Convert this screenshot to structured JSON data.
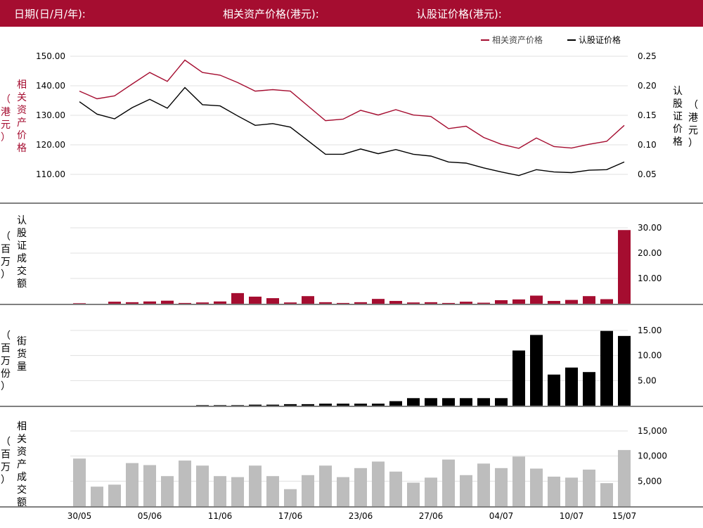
{
  "header": {
    "date_label": "日期(日/月/年):",
    "asset_label": "相关资产价格(港元):",
    "warrant_label": "认股证价格(港元):",
    "bg": "#a50d30"
  },
  "colors": {
    "accent": "#a50d30",
    "black": "#000000",
    "gray": "#bdbdbd",
    "grid": "#e0e0e0"
  },
  "panel_labels": {
    "asset_price": {
      "main": [
        "相",
        "关",
        "资",
        "产",
        "价",
        "格"
      ],
      "unit": [
        "（",
        "港",
        "元",
        "）"
      ]
    },
    "warrant_price": {
      "main": [
        "认",
        "股",
        "证",
        "价",
        "格"
      ],
      "unit": [
        "（",
        "港",
        "元",
        "）"
      ]
    },
    "warrant_turnover": {
      "main": [
        "认",
        "股",
        "证",
        "成",
        "交",
        "额"
      ],
      "unit": [
        "（",
        "百",
        "万",
        "）"
      ]
    },
    "outstanding": {
      "main": [
        "街",
        "货",
        "量"
      ],
      "unit": [
        "（",
        "百",
        "万",
        "份",
        "）"
      ]
    },
    "asset_turnover": {
      "main": [
        "相",
        "关",
        "资",
        "产",
        "成",
        "交",
        "额"
      ],
      "unit": [
        "（",
        "百",
        "万",
        "）"
      ]
    }
  },
  "chart_data": [
    {
      "type": "line",
      "legend": [
        "相关资产价格",
        "认股证价格"
      ],
      "legend_position": "top-right",
      "x_tick_labels": [
        "30/05",
        "05/06",
        "11/06",
        "17/06",
        "23/06",
        "27/06",
        "04/07",
        "10/07",
        "15/07"
      ],
      "y_left": {
        "ticks": [
          "150.00",
          "140.00",
          "130.00",
          "120.00",
          "110.00"
        ],
        "range": [
          103,
          156
        ]
      },
      "y_right": {
        "ticks": [
          "0.25",
          "0.20",
          "0.15",
          "0.10",
          "0.05"
        ],
        "range": [
          0.018,
          0.257
        ]
      },
      "series": [
        {
          "name": "相关资产价格",
          "axis": "left",
          "color": "#a50d30",
          "values": [
            138.2,
            135.6,
            136.6,
            140.6,
            144.5,
            141.5,
            148.7,
            144.5,
            143.6,
            141.1,
            138.2,
            138.7,
            138.2,
            133.2,
            128.2,
            128.7,
            131.7,
            130.1,
            131.9,
            130.1,
            129.6,
            125.5,
            126.3,
            122.5,
            120.2,
            118.8,
            122.3,
            119.4,
            118.9,
            120.2,
            121.2,
            126.6
          ]
        },
        {
          "name": "认股证价格",
          "axis": "right",
          "color": "#000000",
          "values": [
            0.173,
            0.152,
            0.144,
            0.163,
            0.177,
            0.162,
            0.197,
            0.168,
            0.166,
            0.149,
            0.133,
            0.136,
            0.13,
            0.107,
            0.084,
            0.084,
            0.093,
            0.085,
            0.092,
            0.084,
            0.081,
            0.071,
            0.069,
            0.061,
            0.054,
            0.048,
            0.058,
            0.054,
            0.053,
            0.057,
            0.058,
            0.071
          ]
        }
      ]
    },
    {
      "type": "bar",
      "y_right": {
        "ticks": [
          "30.00",
          "20.00",
          "10.00"
        ],
        "range": [
          0,
          30
        ]
      },
      "series": [
        {
          "name": "认股证成交额",
          "color": "#a50d30",
          "values": [
            0.2,
            0,
            0.8,
            0.6,
            0.9,
            1.2,
            0.3,
            0.5,
            0.9,
            4.2,
            2.8,
            2.2,
            0.5,
            3.0,
            0.6,
            0.3,
            0.6,
            1.9,
            1.1,
            0.5,
            0.6,
            0.3,
            0.8,
            0.4,
            1.4,
            1.7,
            3.2,
            1.1,
            1.5,
            3.0,
            1.8,
            29.1
          ]
        }
      ]
    },
    {
      "type": "bar",
      "y_right": {
        "ticks": [
          "15.00",
          "10.00",
          "5.00"
        ],
        "range": [
          0,
          16
        ]
      },
      "series": [
        {
          "name": "街货量",
          "color": "#000000",
          "values": [
            0,
            0,
            0,
            0,
            0,
            0,
            0,
            0.1,
            0.1,
            0.1,
            0.2,
            0.2,
            0.3,
            0.3,
            0.4,
            0.4,
            0.4,
            0.4,
            0.9,
            1.5,
            1.5,
            1.5,
            1.5,
            1.5,
            1.5,
            11.0,
            14.1,
            6.2,
            7.6,
            6.7,
            14.9,
            13.9
          ]
        }
      ]
    },
    {
      "type": "bar",
      "y_right": {
        "ticks": [
          "15,000",
          "10,000",
          "5,000"
        ],
        "range": [
          0,
          16500
        ]
      },
      "series": [
        {
          "name": "相关资产成交额",
          "color": "#bdbdbd",
          "values": [
            9500,
            3900,
            4300,
            8600,
            8200,
            6000,
            9100,
            8100,
            6000,
            5800,
            8100,
            6000,
            3400,
            6200,
            8100,
            5800,
            7600,
            8900,
            6900,
            4700,
            5700,
            9300,
            6200,
            8500,
            7600,
            9900,
            7500,
            5900,
            5700,
            7300,
            4600,
            11200
          ]
        }
      ]
    }
  ]
}
